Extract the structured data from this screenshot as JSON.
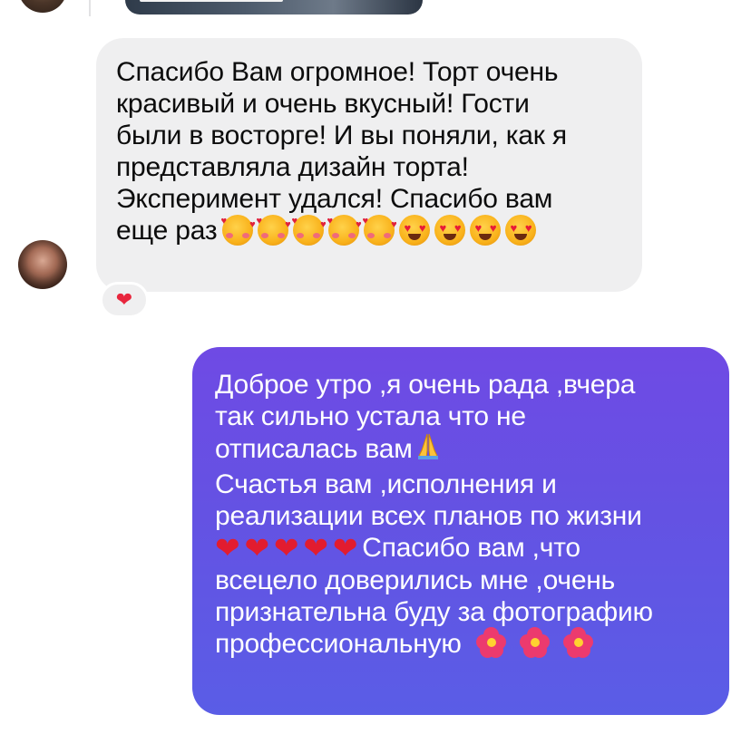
{
  "incoming_message": {
    "lines": [
      "Спасибо Вам огромное! Торт очень",
      "красивый и очень вкусный! Гости",
      "были в восторге! И вы поняли, как я",
      "представляла дизайн торта!",
      "Эксперимент удался! Спасибо вам",
      "еще раз"
    ],
    "emojis": [
      "smiling-face-with-hearts",
      "smiling-face-with-hearts",
      "smiling-face-with-hearts",
      "smiling-face-with-hearts",
      "smiling-face-with-hearts",
      "heart-eyes",
      "heart-eyes",
      "heart-eyes",
      "heart-eyes"
    ],
    "reaction": "❤"
  },
  "outgoing_message": {
    "lines": [
      "Доброе утро ,я очень рада ,вчера",
      "так сильно устала что не",
      "отписалась вам",
      "Счастья вам ,исполнения и",
      "реализации всех планов по жизни",
      "Спасибо вам ,что",
      "всецело доверились мне ,очень",
      "признательна буду за фотографию",
      "профессиональную"
    ],
    "pray_emoji": "folded-hands",
    "hearts": [
      "❤",
      "❤",
      "❤",
      "❤",
      "❤"
    ],
    "flowers": [
      "hibiscus",
      "hibiscus",
      "hibiscus"
    ]
  },
  "colors": {
    "incoming_bubble": "#efeff0",
    "outgoing_bubble_top": "#6f4ae4",
    "outgoing_bubble_bottom": "#5a5de6",
    "heart": "#e21c2f"
  }
}
